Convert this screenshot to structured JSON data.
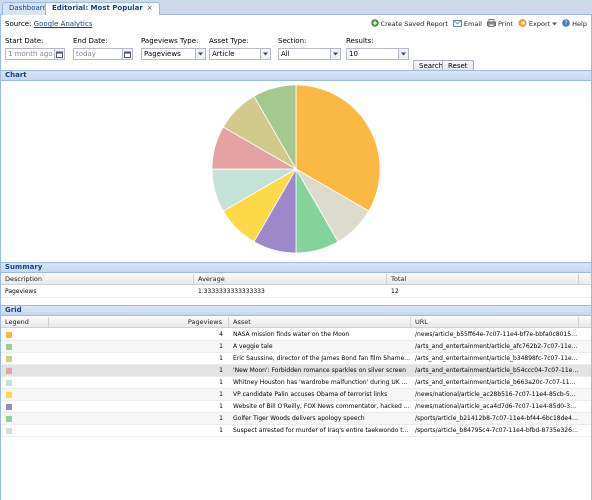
{
  "tabs": [
    {
      "label": "Dashboard",
      "active": false
    },
    {
      "label": "Editorial: Most Popular",
      "active": true,
      "close": "×"
    }
  ],
  "source": {
    "label": "Source:",
    "link": "Google Analytics"
  },
  "actions": [
    {
      "label": "Create Saved Report",
      "icon": "add-icon",
      "color": "#3a9a3a"
    },
    {
      "label": "Email",
      "icon": "email-icon",
      "color": "#6688aa"
    },
    {
      "label": "Print",
      "icon": "print-icon",
      "color": "#888888"
    },
    {
      "label": "Export",
      "icon": "export-icon",
      "color": "#e8b040"
    },
    {
      "label": "Help",
      "icon": "help-icon",
      "color": "#4477bb"
    }
  ],
  "filters": {
    "start_date": {
      "label": "Start Date:",
      "placeholder": "1 month ago"
    },
    "end_date": {
      "label": "End Date:",
      "placeholder": "today"
    },
    "pageviews_type": {
      "label": "Pageviews Type:",
      "value": "Pageviews"
    },
    "asset_type": {
      "label": "Asset Type:",
      "value": "Article"
    },
    "section": {
      "label": "Section:",
      "value": "All"
    },
    "results": {
      "label": "Results:",
      "value": "10"
    },
    "search_label": "Search",
    "reset_label": "Reset"
  },
  "chart_section_title": "Chart",
  "chart_data": {
    "type": "pie",
    "values": [
      4,
      1,
      1,
      1,
      1,
      1,
      1,
      1,
      1
    ],
    "colors": [
      "#fbb944",
      "#dcdbcc",
      "#86d29c",
      "#9d88c9",
      "#fdd849",
      "#c4e2d7",
      "#e5a2a2",
      "#d2c98c",
      "#a5c88e"
    ],
    "labels": [
      "NASA mission finds water on the Moon",
      "A veggie tale",
      "Eric Saussine, director of the James Bond fan film Shamelad...",
      "'New Moon': Fishbone romance sparkles on silver screen",
      "Whitney Houston has 'wardrobe malfunction' during UK debut...",
      "VP candidate Palin accuses Obama of terrorist links",
      "Website of Bill O'Reilly, FOX News commentator, hacked in r...",
      "Golfer Tiger Woods delivers apology speech",
      "Suspect arrested for murder of Iraq's entire taekwondo team"
    ]
  },
  "summary": {
    "title": "Summary",
    "headers": [
      "Description",
      "Average",
      "Total"
    ],
    "rows": [
      [
        "Pageviews",
        "1.3333333333333333",
        "12"
      ]
    ]
  },
  "grid": {
    "title": "Grid",
    "headers": [
      "Legend",
      "Pageviews",
      "Asset",
      "URL"
    ],
    "rows": [
      {
        "color": "#fbb944",
        "pageviews": "4",
        "asset": "NASA mission finds water on the Moon",
        "url": "/news/article_b55ff64e-7c07-11e4-bf7e-bbfa0c801572..."
      },
      {
        "color": "#a5c88e",
        "pageviews": "1",
        "asset": "A veggie tale",
        "url": "/arts_and_entertainment/article_afc762b2-7c07-11e4-b..."
      },
      {
        "color": "#d2c98c",
        "pageviews": "1",
        "asset": "Eric Saussine, director of the James Bond fan film Shamelad...",
        "url": "/arts_and_entertainment/article_b34898fc-7c07-11e4-b..."
      },
      {
        "color": "#e5a2a2",
        "pageviews": "1",
        "asset": "'New Moon': Forbidden romance sparkles on silver screen",
        "url": "/arts_and_entertainment/article_b54ccc04-7c07-11e4-..."
      },
      {
        "color": "#c4e2d7",
        "pageviews": "1",
        "asset": "Whitney Houston has 'wardrobe malfunction' during UK debut...",
        "url": "/arts_and_entertainment/article_b663a20c-7c07-11e4-..."
      },
      {
        "color": "#fdd849",
        "pageviews": "1",
        "asset": "VP candidate Palin accuses Obama of terrorist links",
        "url": "/news/national/article_ac28b516-7c07-11e4-85cb-5771..."
      },
      {
        "color": "#9d88c9",
        "pageviews": "1",
        "asset": "Website of Bill O'Reilly, FOX News commentator, hacked in r...",
        "url": "/news/national/article_aca4d7d6-7c07-11e4-85d0-375a..."
      },
      {
        "color": "#86d29c",
        "pageviews": "1",
        "asset": "Golfer Tiger Woods delivers apology speech",
        "url": "/sports/article_b21412b8-7c07-11e4-bf44-6bc18de4e6..."
      },
      {
        "color": "#dcdbcc",
        "pageviews": "1",
        "asset": "Suspect arrested for murder of Iraq's entire taekwondo team",
        "url": "/sports/article_b84795c4-7c07-11e4-bfbd-8735e326b1..."
      }
    ]
  }
}
